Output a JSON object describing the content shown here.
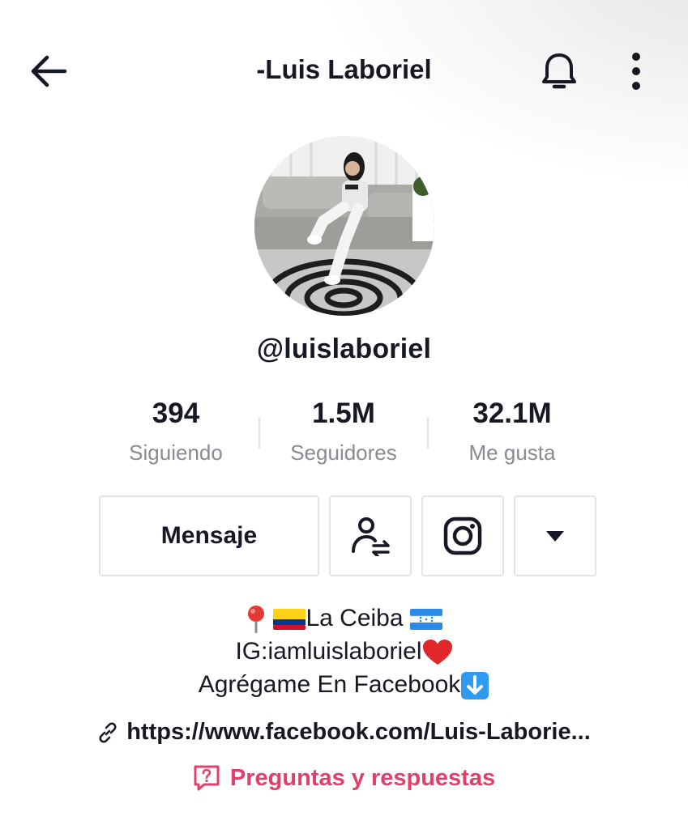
{
  "header": {
    "title": "-Luis Laboriel",
    "icons": [
      "back-arrow-icon",
      "bell-icon",
      "more-vertical-icon"
    ]
  },
  "profile": {
    "username": "@luislaboriel",
    "avatar": "profile-photo"
  },
  "stats": [
    {
      "value": "394",
      "label": "Siguiendo"
    },
    {
      "value": "1.5M",
      "label": "Seguidores"
    },
    {
      "value": "32.1M",
      "label": "Me gusta"
    }
  ],
  "actions": {
    "message_label": "Mensaje",
    "icons": [
      "add-friend-icon",
      "instagram-icon",
      "dropdown-arrow-icon"
    ]
  },
  "bio": {
    "line1": "La Ceiba",
    "line2": "IG:iamluislaboriel",
    "line3": "Agrégame En Facebook"
  },
  "link": {
    "text": "https://www.facebook.com/Luis-Laborie..."
  },
  "qa": {
    "label": "Preguntas y respuestas"
  },
  "colors": {
    "text": "#161823",
    "secondary": "#8a8b91",
    "accent": "#e0416a",
    "border": "#e3e3e4"
  }
}
